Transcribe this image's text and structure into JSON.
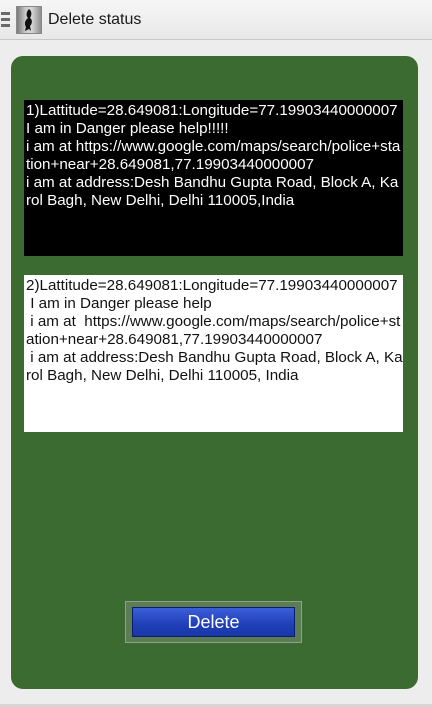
{
  "actionbar": {
    "title": "Delete status"
  },
  "statuses": [
    {
      "text": "1)Lattitude=28.649081:Longitude=77.19903440000007\nI am in Danger please help!!!!!\ni am at https://www.google.com/maps/search/police+station+near+28.649081,77.19903440000007\ni am at address:Desh Bandhu Gupta Road, Block A, Karol Bagh, New Delhi, Delhi 110005,India"
    },
    {
      "text": "2)Lattitude=28.649081:Longitude=77.19903440000007\n I am in Danger please help\n i am at  https://www.google.com/maps/search/police+station+near+28.649081,77.19903440000007\n i am at address:Desh Bandhu Gupta Road, Block A, Karol Bagh, New Delhi, Delhi 110005, India"
    }
  ],
  "delete_label": "Delete",
  "colors": {
    "panel": "#3b6b30",
    "button": "#1f3fb8"
  }
}
